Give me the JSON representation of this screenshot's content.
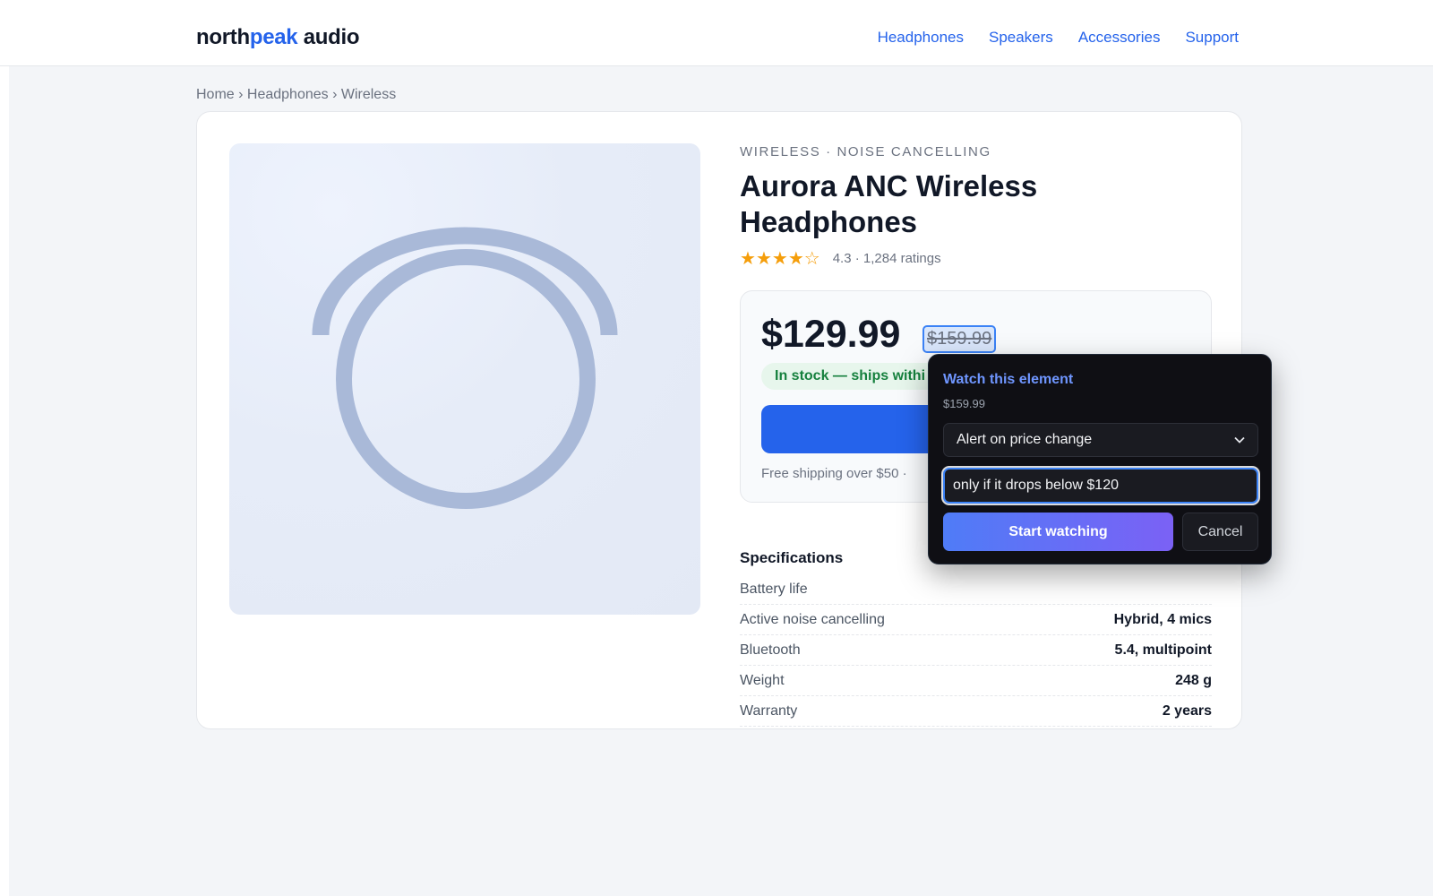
{
  "header": {
    "logo_prefix": "north",
    "logo_accent": "peak",
    "logo_suffix": " audio",
    "nav": [
      "Headphones",
      "Speakers",
      "Accessories",
      "Support"
    ]
  },
  "breadcrumb": "Home › Headphones › Wireless",
  "product": {
    "eyebrow": "WIRELESS · NOISE CANCELLING",
    "title": "Aurora ANC Wireless Headphones",
    "rating_value": 4.3,
    "rating_max": 5,
    "rating_text": "4.3 · 1,284 ratings",
    "price": "$129.99",
    "old_price": "$159.99",
    "stock": "In stock — ships withi",
    "shipping": "Free shipping over $50 ·"
  },
  "specs": {
    "title": "Specifications",
    "rows": [
      {
        "label": "Battery life",
        "value": ""
      },
      {
        "label": "Active noise cancelling",
        "value": "Hybrid, 4 mics"
      },
      {
        "label": "Bluetooth",
        "value": "5.4, multipoint"
      },
      {
        "label": "Weight",
        "value": "248 g"
      },
      {
        "label": "Warranty",
        "value": "2 years"
      }
    ]
  },
  "watch_popup": {
    "title": "Watch this element",
    "element_value": "$159.99",
    "mode_selected": "Alert on price change",
    "condition_value": "only if it drops below $120",
    "start_label": "Start watching",
    "cancel_label": "Cancel"
  },
  "colors": {
    "accent": "#2563eb",
    "star": "#f59e0b",
    "stock_green": "#15803d",
    "popup_bg": "#0f0f14"
  },
  "icons": {
    "star": "star-icon",
    "select_chevron": "chevron-down-icon",
    "product_art": "headphones-icon"
  }
}
